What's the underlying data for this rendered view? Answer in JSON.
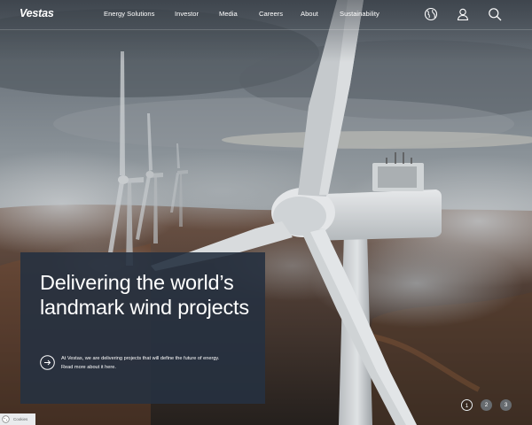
{
  "header": {
    "logo": "Vestas",
    "nav": [
      "Energy Solutions",
      "Investor",
      "Media",
      "Careers",
      "About",
      "Sustainability"
    ],
    "icons": [
      "globe-icon",
      "user-icon",
      "search-icon"
    ]
  },
  "hero": {
    "title": "Delivering the world’s landmark wind projects",
    "description": "At Vestas, we are delivering projects that will define the future of energy. Read more about it here.",
    "cta_icon": "arrow-right-circle-icon"
  },
  "carousel": {
    "slides": [
      "1",
      "2",
      "3"
    ],
    "active": "1"
  },
  "cookie": {
    "label": "Cookies",
    "icon": "cookie-icon"
  },
  "colors": {
    "card": "#263140",
    "text": "#ffffff"
  }
}
